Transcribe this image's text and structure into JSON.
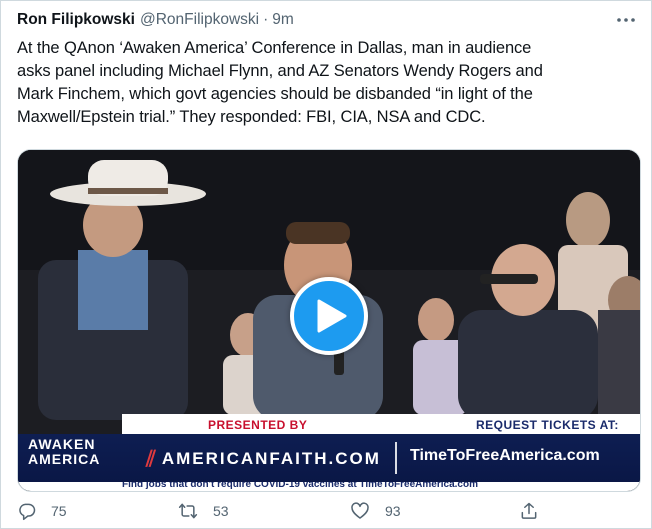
{
  "tweet": {
    "author_name": "Ron Filipkowski",
    "author_handle": "@RonFilipkowski",
    "separator": "·",
    "timestamp": "9m",
    "text": "At the QAnon ‘Awaken America’ Conference in Dallas, man in audience\nasks panel including Michael Flynn, and AZ Senators Wendy Rogers and\nMark Finchem, which govt agencies should be disbanded “in light of the\nMaxwell/Epstein trial.” They responded: FBI, CIA, NSA and CDC."
  },
  "video": {
    "banner_presented_by": "PRESENTED BY",
    "banner_request_tickets": "REQUEST TICKETS AT:",
    "logo_line1": "AWAKEN",
    "logo_line2": "AMERICA",
    "sponsor": "AMERICANFAITH.COM",
    "site": "TimeToFreeAmerica.com",
    "ticker": "Find jobs that don't require COVID-19 vaccines at TimeToFreeAmerica.com"
  },
  "actions": {
    "replies": "75",
    "retweets": "53",
    "likes": "93"
  },
  "colors": {
    "accent": "#1d9bf0",
    "muted": "#536471",
    "banner_navy": "#0e1e52",
    "banner_red": "#c8102e"
  },
  "icons": [
    "more-icon",
    "play-icon",
    "reply-icon",
    "retweet-icon",
    "like-icon",
    "share-icon"
  ]
}
